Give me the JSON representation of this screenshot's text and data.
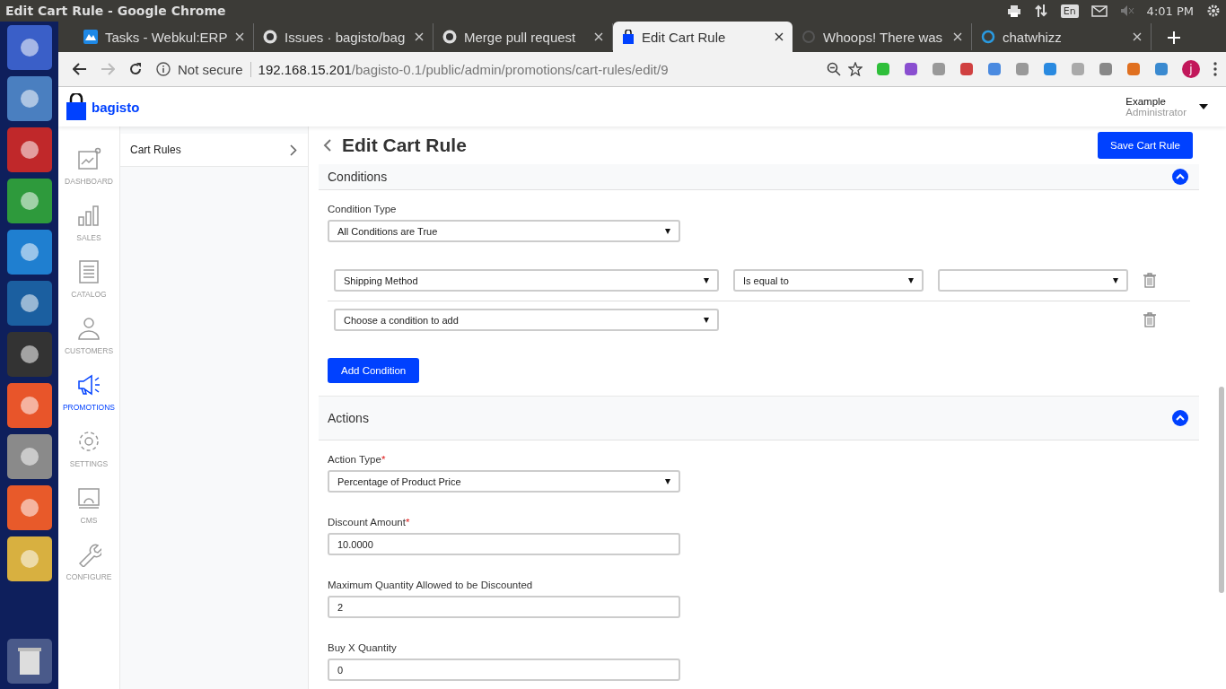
{
  "system_bar": {
    "title": "Edit Cart Rule - Google Chrome",
    "keyboard": "En",
    "time": "4:01 PM"
  },
  "browser": {
    "tabs": [
      {
        "label": "Tasks - Webkul:ERP",
        "kind": "webkul",
        "selected": false
      },
      {
        "label": "Issues · bagisto/bag",
        "kind": "github",
        "selected": false
      },
      {
        "label": "Merge pull request",
        "kind": "github",
        "selected": false
      },
      {
        "label": "Edit Cart Rule",
        "kind": "bag",
        "selected": true
      },
      {
        "label": "Whoops! There was",
        "kind": "spinner",
        "selected": false
      },
      {
        "label": "chatwhizz",
        "kind": "chat",
        "selected": false
      }
    ],
    "security": "Not secure",
    "url_host": "192.168.15.201",
    "url_path": "/bagisto-0.1/public/admin/promotions/cart-rules/edit/9",
    "profile": "j"
  },
  "header": {
    "logo": "bagisto",
    "user_name": "Example",
    "user_role": "Administrator"
  },
  "nav": [
    {
      "label": "DASHBOARD",
      "kind": "dashboard",
      "selected": false
    },
    {
      "label": "SALES",
      "kind": "sales",
      "selected": false
    },
    {
      "label": "CATALOG",
      "kind": "catalog",
      "selected": false
    },
    {
      "label": "CUSTOMERS",
      "kind": "customers",
      "selected": false
    },
    {
      "label": "PROMOTIONS",
      "kind": "promotions",
      "selected": true
    },
    {
      "label": "SETTINGS",
      "kind": "settings",
      "selected": false
    },
    {
      "label": "CMS",
      "kind": "cms",
      "selected": false
    },
    {
      "label": "CONFIGURE",
      "kind": "configure",
      "selected": false
    }
  ],
  "subnav": [
    {
      "label": "Cart Rules"
    }
  ],
  "page": {
    "title": "Edit Cart Rule",
    "save_button": "Save Cart Rule"
  },
  "conditions": {
    "title": "Conditions",
    "expanded": true,
    "condition_type_label": "Condition Type",
    "condition_type": "All Conditions are True",
    "rows": [
      {
        "attribute": "Shipping Method",
        "operator": "Is equal to",
        "value": ""
      },
      {
        "attribute": "Choose a condition to add"
      }
    ],
    "add_button": "Add Condition"
  },
  "actions": {
    "title": "Actions",
    "expanded": true,
    "fields": [
      {
        "kind": "select",
        "label": "Action Type",
        "required_mark": "*",
        "value": "Percentage of Product Price"
      },
      {
        "kind": "input",
        "label": "Discount Amount",
        "required_mark": "*",
        "value": "10.0000"
      },
      {
        "kind": "input",
        "label": "Maximum Quantity Allowed to be Discounted",
        "value": "2"
      },
      {
        "kind": "input",
        "label": "Buy X Quantity",
        "value": "0"
      }
    ]
  }
}
